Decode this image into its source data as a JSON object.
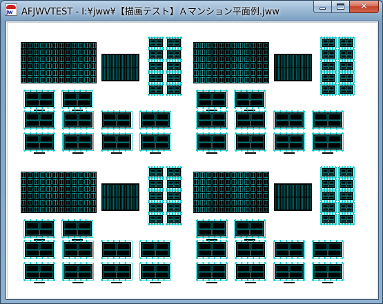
{
  "window": {
    "title": "AFJWVTEST - I:¥jww¥【描画テスト】Ａマンション平面例.jww",
    "icon": "jww-app-icon",
    "icon_text": "jw"
  },
  "caption_buttons": {
    "minimize_icon": "minimize-icon",
    "maximize_icon": "maximize-icon",
    "close_icon": "close-icon",
    "close_glyph": "✕"
  },
  "drawing": {
    "content": "CAD floor plan drawing (repeated apartment layout, 4 quadrants)",
    "colors": {
      "background": "#ffffff",
      "linework": "#000000",
      "dimension_lines": "#00c8c8",
      "frame": "#000000"
    }
  }
}
